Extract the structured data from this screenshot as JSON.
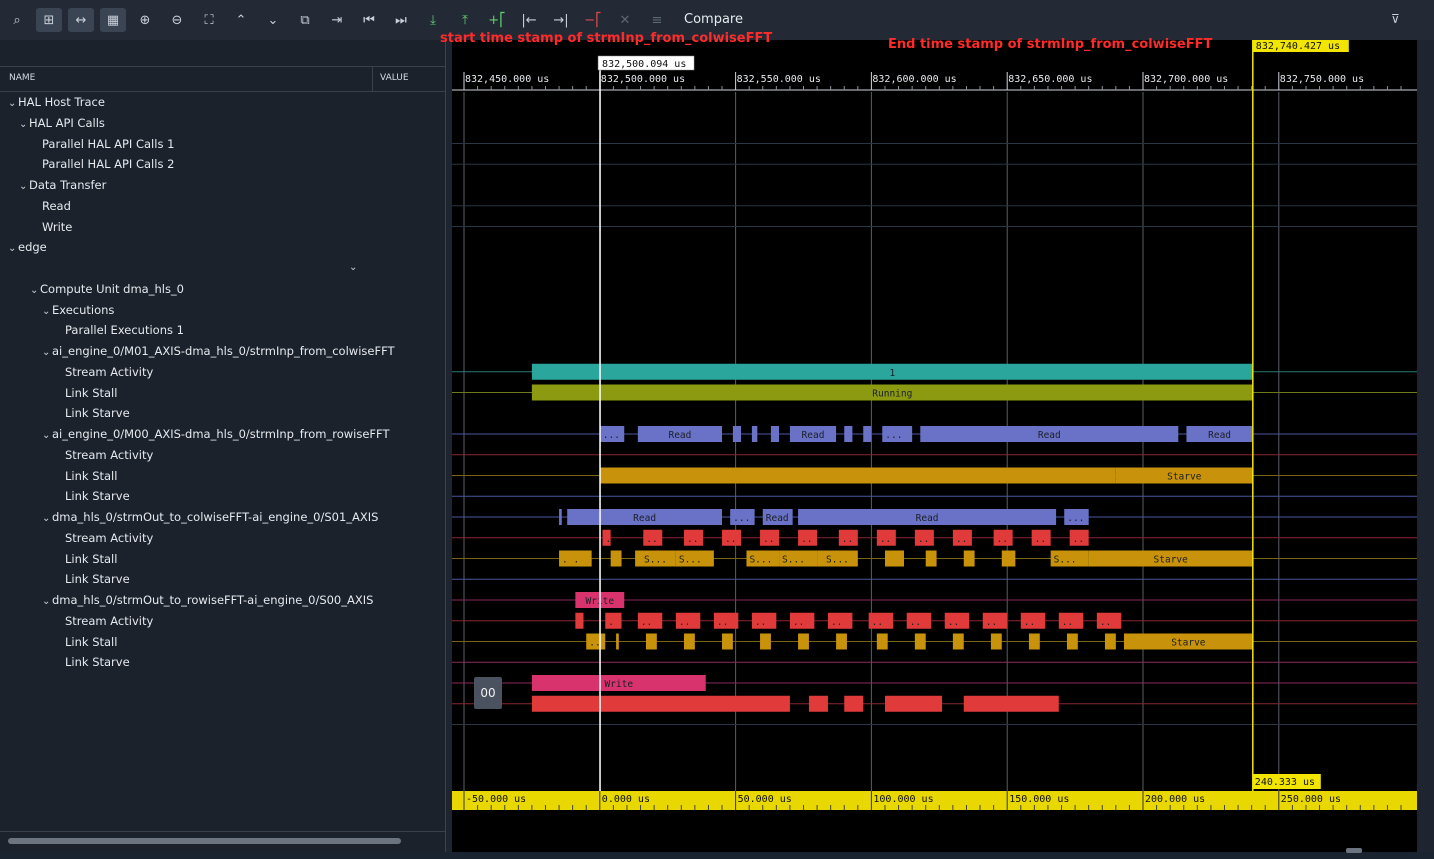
{
  "toolbar": {
    "compare_label": "Compare",
    "buttons": [
      {
        "name": "search-icon",
        "glyph": "⌕"
      },
      {
        "name": "hierarchy-icon",
        "glyph": "⊞"
      },
      {
        "name": "fit-width-icon",
        "glyph": "↔"
      },
      {
        "name": "grid-icon",
        "glyph": "▦"
      },
      {
        "name": "zoom-in-icon",
        "glyph": "⊕"
      },
      {
        "name": "zoom-out-icon",
        "glyph": "⊖"
      },
      {
        "name": "zoom-fit-icon",
        "glyph": "⛶"
      },
      {
        "name": "expand-up-icon",
        "glyph": "⌃"
      },
      {
        "name": "collapse-down-icon",
        "glyph": "⌄"
      },
      {
        "name": "compare-icon",
        "glyph": "⧉"
      },
      {
        "name": "marker-set-icon",
        "glyph": "⇥"
      },
      {
        "name": "go-start-icon",
        "glyph": "⏮"
      },
      {
        "name": "go-end-icon",
        "glyph": "⏭"
      },
      {
        "name": "marker-prev-icon",
        "glyph": "⤓"
      },
      {
        "name": "marker-next-icon",
        "glyph": "⤒"
      },
      {
        "name": "add-marker-icon",
        "glyph": "+⎡"
      },
      {
        "name": "marker-left-icon",
        "glyph": "|←"
      },
      {
        "name": "marker-right-icon",
        "glyph": "→|"
      },
      {
        "name": "remove-marker-icon",
        "glyph": "−⎡"
      },
      {
        "name": "close-icon",
        "glyph": "✕"
      },
      {
        "name": "menu-icon",
        "glyph": "≡"
      }
    ],
    "filter_icon": "⊽"
  },
  "tree": {
    "col_name": "NAME",
    "col_value": "VALUE",
    "rows": [
      {
        "label": "HAL Host Trace",
        "indent": 0,
        "chevron": true
      },
      {
        "label": "HAL API Calls",
        "indent": 1,
        "chevron": true
      },
      {
        "label": "Parallel HAL API Calls 1",
        "indent": 2,
        "chevron": false
      },
      {
        "label": "Parallel HAL API Calls 2",
        "indent": 2,
        "chevron": false
      },
      {
        "label": "Data Transfer",
        "indent": 1,
        "chevron": true
      },
      {
        "label": "Read",
        "indent": 2,
        "chevron": false
      },
      {
        "label": "Write",
        "indent": 2,
        "chevron": false
      },
      {
        "label": "edge",
        "indent": 0,
        "chevron": true
      },
      {
        "label": "",
        "indent": 0,
        "chevron": false
      },
      {
        "label": "Compute Unit dma_hls_0",
        "indent": 2,
        "chevron": true
      },
      {
        "label": "Executions",
        "indent": 3,
        "chevron": true
      },
      {
        "label": "Parallel Executions 1",
        "indent": 4,
        "chevron": false
      },
      {
        "label": "ai_engine_0/M01_AXIS-dma_hls_0/strmInp_from_colwiseFFT",
        "indent": 3,
        "chevron": true
      },
      {
        "label": "Stream Activity",
        "indent": 4,
        "chevron": false
      },
      {
        "label": "Link Stall",
        "indent": 4,
        "chevron": false
      },
      {
        "label": "Link Starve",
        "indent": 4,
        "chevron": false
      },
      {
        "label": "ai_engine_0/M00_AXIS-dma_hls_0/strmInp_from_rowiseFFT",
        "indent": 3,
        "chevron": true
      },
      {
        "label": "Stream Activity",
        "indent": 4,
        "chevron": false
      },
      {
        "label": "Link Stall",
        "indent": 4,
        "chevron": false
      },
      {
        "label": "Link Starve",
        "indent": 4,
        "chevron": false
      },
      {
        "label": "dma_hls_0/strmOut_to_colwiseFFT-ai_engine_0/S01_AXIS",
        "indent": 3,
        "chevron": true
      },
      {
        "label": "Stream Activity",
        "indent": 4,
        "chevron": false
      },
      {
        "label": "Link Stall",
        "indent": 4,
        "chevron": false
      },
      {
        "label": "Link Starve",
        "indent": 4,
        "chevron": false
      },
      {
        "label": "dma_hls_0/strmOut_to_rowiseFFT-ai_engine_0/S00_AXIS",
        "indent": 3,
        "chevron": true
      },
      {
        "label": "Stream Activity",
        "indent": 4,
        "chevron": false
      },
      {
        "label": "Link Stall",
        "indent": 4,
        "chevron": false
      },
      {
        "label": "Link Starve",
        "indent": 4,
        "chevron": false
      }
    ]
  },
  "annotations": {
    "start": "start time stamp of strmInp_from_colwiseFFT",
    "end": "End time stamp of strmInp_from_colwiseFFT"
  },
  "timeline": {
    "start_us": 832450.0,
    "end_us": 832785.0,
    "top_ticks": [
      "832,450.000 us",
      "832,500.000 us",
      "832,550.000 us",
      "832,600.000 us",
      "832,650.000 us",
      "832,700.000 us",
      "832,750.000 us"
    ],
    "top_tick_values": [
      832450,
      832500,
      832550,
      832600,
      832650,
      832700,
      832750
    ],
    "bottom_ticks": [
      "-50.000 us",
      "0.000 us",
      "50.000 us",
      "100.000 us",
      "150.000 us",
      "200.000 us",
      "250.000 us"
    ],
    "bottom_tick_values": [
      -50,
      0,
      50,
      100,
      150,
      200,
      250
    ],
    "cursor_white_us": 832500.094,
    "cursor_white_label": "832,500.094 us",
    "cursor_yellow_us": 832740.427,
    "cursor_yellow_label": "832,740.427 us",
    "delta_label": "240.333 us"
  },
  "tracks": [
    {
      "row": 13,
      "type": "teal",
      "segments": [
        [
          832475,
          832740.4,
          "1"
        ]
      ]
    },
    {
      "row": 14,
      "type": "olive",
      "segments": [
        [
          832475,
          832740.4,
          "Running"
        ]
      ]
    },
    {
      "row": 16,
      "type": "read",
      "segments": [
        [
          832500,
          832509,
          "..."
        ],
        [
          832514,
          832545,
          "Read"
        ],
        [
          832549,
          832552,
          ""
        ],
        [
          832556,
          832558,
          ""
        ],
        [
          832563,
          832566,
          ""
        ],
        [
          832570,
          832587,
          "Read"
        ],
        [
          832590,
          832593,
          ""
        ],
        [
          832597,
          832600,
          ""
        ],
        [
          832604,
          832615,
          "..."
        ],
        [
          832618,
          832713,
          "Read"
        ],
        [
          832716,
          832740.4,
          "Read"
        ]
      ]
    },
    {
      "row": 18,
      "type": "starve",
      "segments": [
        [
          832500,
          832690,
          ""
        ],
        [
          832690,
          832740.4,
          "Starve"
        ]
      ]
    },
    {
      "row": 20,
      "type": "read",
      "segments": [
        [
          832485,
          832486,
          ""
        ],
        [
          832488,
          832545,
          "Read"
        ],
        [
          832548,
          832557,
          "..."
        ],
        [
          832560,
          832571,
          "Read"
        ],
        [
          832573,
          832668,
          "Read"
        ],
        [
          832671,
          832680,
          "..."
        ]
      ]
    },
    {
      "row": 21,
      "type": "stall",
      "segments": [
        [
          832501,
          832504,
          "."
        ],
        [
          832516,
          832523,
          ".."
        ],
        [
          832531,
          832538,
          ".."
        ],
        [
          832545,
          832552,
          ".."
        ],
        [
          832559,
          832566,
          ".."
        ],
        [
          832573,
          832580,
          ".."
        ],
        [
          832588,
          832595,
          ".."
        ],
        [
          832602,
          832609,
          ".."
        ],
        [
          832616,
          832623,
          ".."
        ],
        [
          832630,
          832637,
          ".."
        ],
        [
          832645,
          832652,
          ".."
        ],
        [
          832659,
          832666,
          ".."
        ],
        [
          832673,
          832680,
          ".."
        ]
      ]
    },
    {
      "row": 22,
      "type": "starve",
      "segments": [
        [
          832485,
          832497,
          ". ."
        ],
        [
          832504,
          832508,
          ""
        ],
        [
          832513,
          832528,
          "S..."
        ],
        [
          832528,
          832542,
          "S..."
        ],
        [
          832554,
          832566,
          "S..."
        ],
        [
          832566,
          832580,
          "S..."
        ],
        [
          832580,
          832595,
          "S..."
        ],
        [
          832605,
          832612,
          ""
        ],
        [
          832620,
          832624,
          ""
        ],
        [
          832634,
          832638,
          ""
        ],
        [
          832648,
          832653,
          ""
        ],
        [
          832666,
          832680,
          "S..."
        ],
        [
          832680,
          832740.4,
          "Starve"
        ]
      ]
    },
    {
      "row": 24,
      "type": "write",
      "segments": [
        [
          832491,
          832509,
          "Write"
        ]
      ]
    },
    {
      "row": 25,
      "type": "stall",
      "segments": [
        [
          832491,
          832494,
          ""
        ],
        [
          832502,
          832508,
          "."
        ],
        [
          832514,
          832523,
          ".."
        ],
        [
          832528,
          832537,
          ".."
        ],
        [
          832542,
          832551,
          ".."
        ],
        [
          832556,
          832565,
          ".."
        ],
        [
          832570,
          832579,
          ".."
        ],
        [
          832584,
          832593,
          ".."
        ],
        [
          832599,
          832608,
          ".."
        ],
        [
          832613,
          832622,
          ".."
        ],
        [
          832627,
          832636,
          ".."
        ],
        [
          832641,
          832650,
          ".."
        ],
        [
          832655,
          832664,
          ".."
        ],
        [
          832669,
          832678,
          ".."
        ],
        [
          832683,
          832692,
          ".."
        ]
      ]
    },
    {
      "row": 26,
      "type": "starve",
      "segments": [
        [
          832495,
          832502,
          ".."
        ],
        [
          832506,
          832507,
          ""
        ],
        [
          832517,
          832521,
          ""
        ],
        [
          832531,
          832535,
          ""
        ],
        [
          832545,
          832549,
          ""
        ],
        [
          832559,
          832563,
          ""
        ],
        [
          832573,
          832577,
          ""
        ],
        [
          832587,
          832591,
          ""
        ],
        [
          832602,
          832606,
          ""
        ],
        [
          832616,
          832620,
          ""
        ],
        [
          832630,
          832634,
          ""
        ],
        [
          832644,
          832648,
          ""
        ],
        [
          832658,
          832662,
          ""
        ],
        [
          832672,
          832676,
          ""
        ],
        [
          832686,
          832690,
          ""
        ],
        [
          832693,
          832740.4,
          "Starve"
        ]
      ]
    },
    {
      "row": 28,
      "type": "write",
      "segments": [
        [
          832475,
          832539,
          "Write"
        ]
      ]
    },
    {
      "row": 29,
      "type": "stall",
      "segments": [
        [
          832475,
          832570,
          ""
        ],
        [
          832577,
          832584,
          ""
        ],
        [
          832590,
          832597,
          ""
        ],
        [
          832605,
          832626,
          ""
        ],
        [
          832634,
          832669,
          ""
        ]
      ]
    }
  ]
}
